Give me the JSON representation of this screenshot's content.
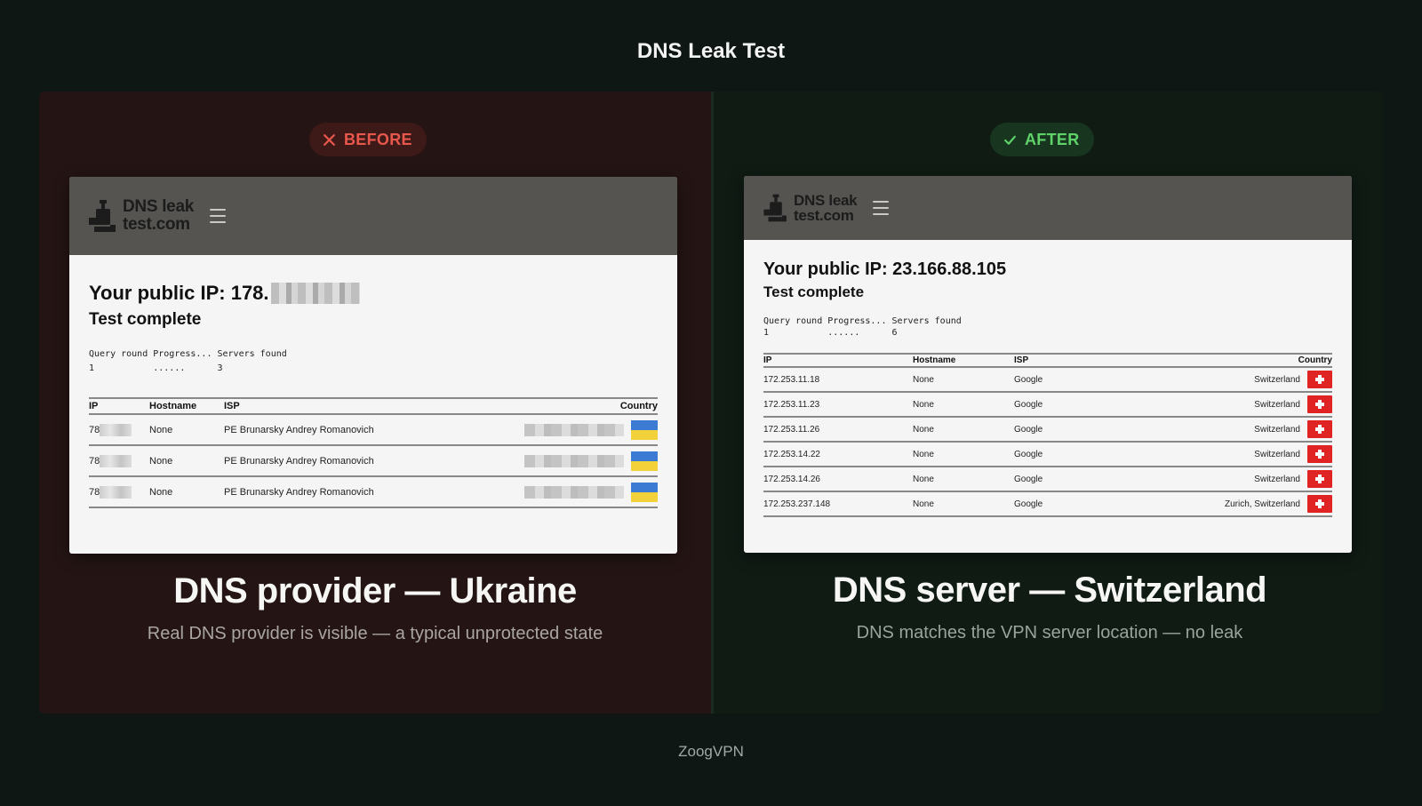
{
  "page_title": "DNS Leak Test",
  "footer": "ZoogVPN",
  "colors": {
    "before_accent": "#e8574c",
    "after_accent": "#5fd36a",
    "before_bg": "#241514",
    "after_bg": "#101b14"
  },
  "before": {
    "badge": {
      "label": "BEFORE",
      "icon": "close-icon"
    },
    "site": {
      "logo_line1": "DNS leak",
      "logo_line2": "test.com",
      "ip_label": "Your public IP: 178.",
      "status": "Test complete",
      "progress_header": "Query round Progress... Servers found",
      "progress_values": "1           ......      3",
      "table": {
        "headers": [
          "IP",
          "Hostname",
          "ISP",
          "Country"
        ],
        "rows": [
          {
            "ip": "78",
            "hostname": "None",
            "isp": "PE Brunarsky Andrey Romanovich",
            "flag": "ukraine-flag-icon"
          },
          {
            "ip": "78",
            "hostname": "None",
            "isp": "PE Brunarsky Andrey Romanovich",
            "flag": "ukraine-flag-icon"
          },
          {
            "ip": "78",
            "hostname": "None",
            "isp": "PE Brunarsky Andrey Romanovich",
            "flag": "ukraine-flag-icon"
          }
        ]
      }
    },
    "caption": {
      "title": "DNS provider — Ukraine",
      "subtitle": "Real DNS provider is visible — a typical unprotected state"
    }
  },
  "after": {
    "badge": {
      "label": "AFTER",
      "icon": "check-icon"
    },
    "site": {
      "logo_line1": "DNS leak",
      "logo_line2": "test.com",
      "ip_label": "Your public IP: 23.166.88.105",
      "status": "Test complete",
      "progress_header": "Query round Progress... Servers found",
      "progress_values": "1           ......      6",
      "table": {
        "headers": [
          "IP",
          "Hostname",
          "ISP",
          "Country"
        ],
        "rows": [
          {
            "ip": "172.253.11.18",
            "hostname": "None",
            "isp": "Google",
            "country": "Switzerland",
            "flag": "switzerland-flag-icon"
          },
          {
            "ip": "172.253.11.23",
            "hostname": "None",
            "isp": "Google",
            "country": "Switzerland",
            "flag": "switzerland-flag-icon"
          },
          {
            "ip": "172.253.11.26",
            "hostname": "None",
            "isp": "Google",
            "country": "Switzerland",
            "flag": "switzerland-flag-icon"
          },
          {
            "ip": "172.253.14.22",
            "hostname": "None",
            "isp": "Google",
            "country": "Switzerland",
            "flag": "switzerland-flag-icon"
          },
          {
            "ip": "172.253.14.26",
            "hostname": "None",
            "isp": "Google",
            "country": "Switzerland",
            "flag": "switzerland-flag-icon"
          },
          {
            "ip": "172.253.237.148",
            "hostname": "None",
            "isp": "Google",
            "country": "Zurich, Switzerland",
            "flag": "switzerland-flag-icon"
          }
        ]
      }
    },
    "caption": {
      "title": "DNS server — Switzerland",
      "subtitle": "DNS matches the VPN server location — no leak"
    }
  }
}
